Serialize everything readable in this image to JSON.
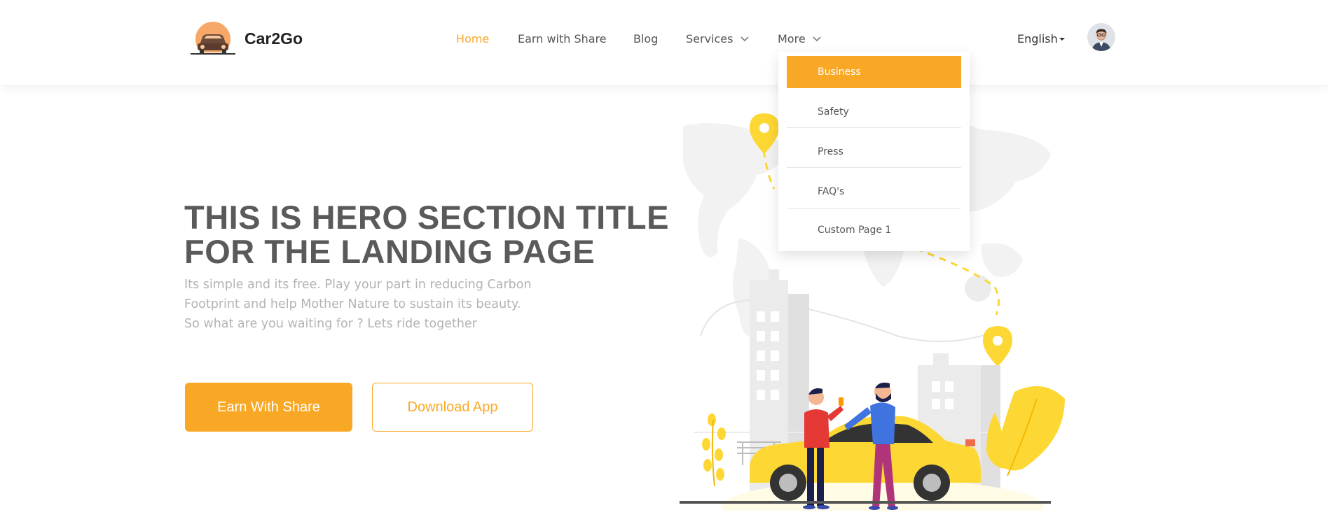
{
  "brand": {
    "name": "Car2Go",
    "logo_icon": "car-logo-icon"
  },
  "nav": {
    "items": [
      {
        "label": "Home",
        "active": true
      },
      {
        "label": "Earn with Share",
        "active": false
      },
      {
        "label": "Blog",
        "active": false
      },
      {
        "label": "Services",
        "has_dropdown": true
      },
      {
        "label": "More",
        "has_dropdown": true,
        "open": true
      }
    ],
    "language": "English",
    "avatar_icon": "user-avatar"
  },
  "dropdown": {
    "items": [
      "Business",
      "Safety",
      "Press",
      "FAQ's",
      "Custom Page 1"
    ],
    "selected": "Business"
  },
  "hero": {
    "title_lines": [
      "THIS IS HERO SECTION TITLE",
      "FOR THE LANDING PAGE"
    ],
    "subtitle_lines": [
      "Its simple and its free. Play your part in reducing Carbon",
      "Footprint and help Mother Nature to sustain its beauty.",
      "So what are you waiting for ? Lets ride together"
    ],
    "primary_button": "Earn With Share",
    "secondary_button": "Download App"
  },
  "colors": {
    "accent": "#F9A826",
    "title": "#5a5a5a",
    "subtitle": "#b3b3b3",
    "illustration_yellow": "#FDD835"
  }
}
